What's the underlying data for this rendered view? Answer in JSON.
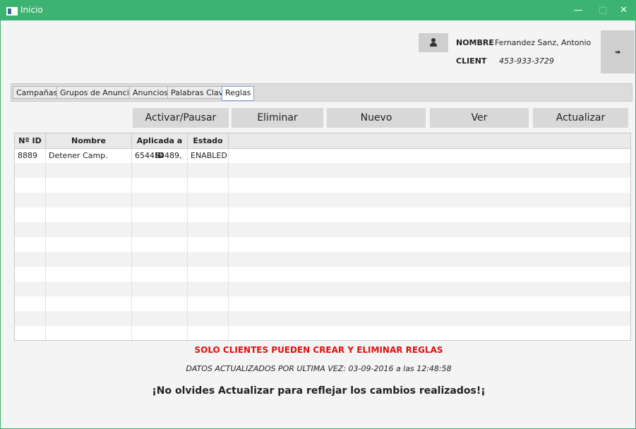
{
  "window": {
    "title": "Inicio",
    "controls": {
      "minimize": "—",
      "maximize": "□",
      "close": "✕"
    }
  },
  "user": {
    "icon": "user-icon",
    "name_label": "NOMBRE",
    "name_value": "Fernandez Sanz, Antonio",
    "client_label": "CLIENT",
    "client_value": "453-933-3729",
    "logout_icon": "logout-icon",
    "logout_glyph": "➠"
  },
  "tabs": [
    {
      "label": "Campañas"
    },
    {
      "label": "Grupos de Anuncios"
    },
    {
      "label": "Anuncios"
    },
    {
      "label": "Palabras Clave"
    },
    {
      "label": "Reglas"
    }
  ],
  "active_tab": "Reglas",
  "toolbar": {
    "activate_pause": "Activar/Pausar",
    "delete": "Eliminar",
    "new": "Nuevo",
    "view": "Ver",
    "refresh": "Actualizar"
  },
  "table": {
    "columns": [
      "Nº ID",
      "Nombre",
      "Aplicada a ID",
      "Estado"
    ],
    "rows": [
      [
        "8889",
        "Detener Camp. Abonos",
        "654454489,",
        "ENABLED"
      ]
    ]
  },
  "messages": {
    "warning": "SOLO CLIENTES PUEDEN CREAR Y ELIMINAR REGLAS",
    "updated": "DATOS ACTUALIZADOS POR ULTIMA VEZ: 03-09-2016 a las 12:48:58",
    "reminder": "¡No olvides Actualizar para reflejar los cambios realizados!¡"
  },
  "colors": {
    "titlebar": "#3cb371",
    "warning": "#e01010"
  }
}
